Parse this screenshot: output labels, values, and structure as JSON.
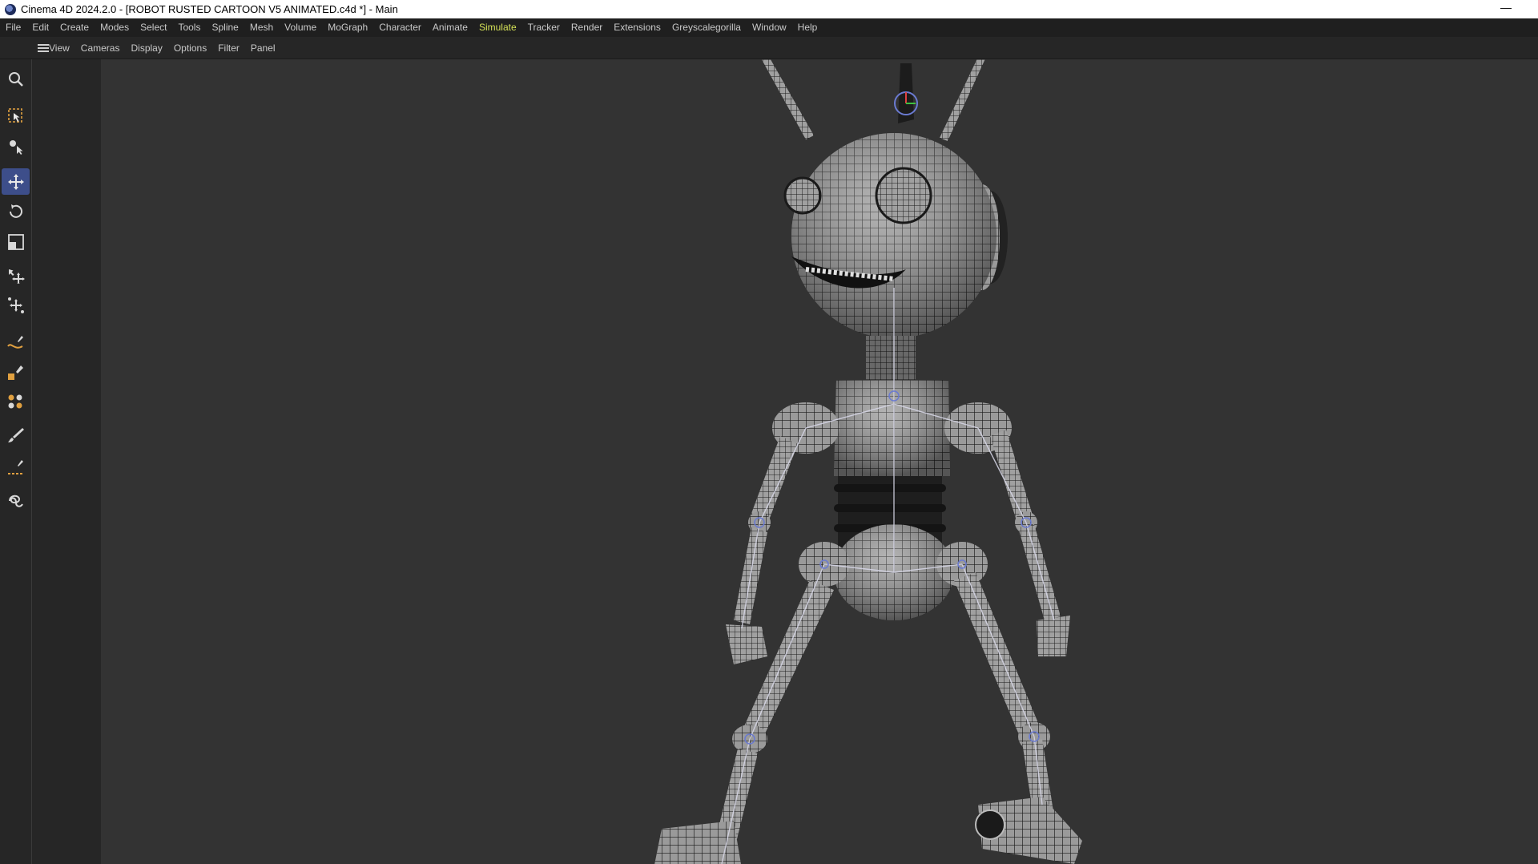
{
  "window": {
    "title": "Cinema 4D 2024.2.0 - [ROBOT RUSTED CARTOON V5 ANIMATED.c4d *] - Main",
    "minimize_symbol": "—"
  },
  "menu": [
    {
      "label": "File"
    },
    {
      "label": "Edit"
    },
    {
      "label": "Create"
    },
    {
      "label": "Modes"
    },
    {
      "label": "Select"
    },
    {
      "label": "Tools"
    },
    {
      "label": "Spline"
    },
    {
      "label": "Mesh"
    },
    {
      "label": "Volume"
    },
    {
      "label": "MoGraph"
    },
    {
      "label": "Character"
    },
    {
      "label": "Animate"
    },
    {
      "label": "Simulate"
    },
    {
      "label": "Tracker"
    },
    {
      "label": "Render"
    },
    {
      "label": "Extensions"
    },
    {
      "label": "Greyscalegorilla"
    },
    {
      "label": "Window"
    },
    {
      "label": "Help"
    }
  ],
  "menu_highlight": "Simulate",
  "viewport_menu": [
    {
      "label": "View"
    },
    {
      "label": "Cameras"
    },
    {
      "label": "Display"
    },
    {
      "label": "Options"
    },
    {
      "label": "Filter"
    },
    {
      "label": "Panel"
    }
  ],
  "tools": [
    {
      "name": "search-icon"
    },
    {
      "name": "live-selection-icon"
    },
    {
      "name": "object-tool-icon"
    },
    {
      "name": "move-icon",
      "active": true
    },
    {
      "name": "rotate-icon"
    },
    {
      "name": "scale-icon"
    },
    {
      "name": "transform-icon"
    },
    {
      "name": "multi-transform-icon"
    },
    {
      "name": "spline-pen-icon"
    },
    {
      "name": "spline-cube-icon"
    },
    {
      "name": "cloner-icon"
    },
    {
      "name": "brush-icon"
    },
    {
      "name": "knife-icon"
    },
    {
      "name": "lasso-icon"
    }
  ],
  "colors": {
    "accent": "#3d4e8a",
    "menu_highlight": "#d4e157",
    "viewport_bg": "#333333"
  }
}
